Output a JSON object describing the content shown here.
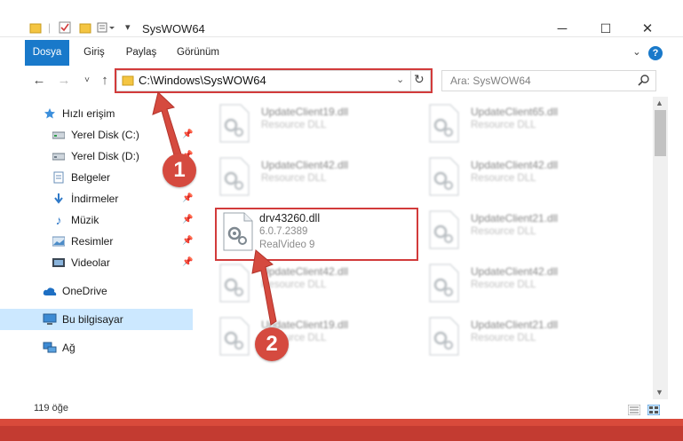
{
  "window": {
    "title": "SysWOW64",
    "minimize": "─",
    "maximize": "☐",
    "close": "✕"
  },
  "ribbon": {
    "tabs": [
      {
        "label": "Dosya",
        "active": true
      },
      {
        "label": "Giriş",
        "active": false
      },
      {
        "label": "Paylaş",
        "active": false
      },
      {
        "label": "Görünüm",
        "active": false
      }
    ],
    "help": "?"
  },
  "address": {
    "path": "C:\\Windows\\SysWOW64",
    "search_placeholder": "Ara: SysWOW64"
  },
  "sidebar": {
    "items": [
      {
        "label": "Hızlı erişim",
        "icon": "star-icon"
      },
      {
        "label": "Yerel Disk (C:)",
        "icon": "drive-icon"
      },
      {
        "label": "Yerel Disk (D:)",
        "icon": "drive-icon"
      },
      {
        "label": "Belgeler",
        "icon": "documents-icon"
      },
      {
        "label": "İndirmeler",
        "icon": "download-icon"
      },
      {
        "label": "Müzik",
        "icon": "music-icon"
      },
      {
        "label": "Resimler",
        "icon": "pictures-icon"
      },
      {
        "label": "Videolar",
        "icon": "videos-icon"
      },
      {
        "label": "OneDrive",
        "icon": "cloud-icon"
      },
      {
        "label": "Bu bilgisayar",
        "icon": "computer-icon"
      },
      {
        "label": "Ağ",
        "icon": "network-icon"
      }
    ]
  },
  "files": [
    {
      "name": "UpdateClient19.dll",
      "type": "Resource DLL"
    },
    {
      "name": "UpdateClient65.dll",
      "type": "Resource DLL"
    },
    {
      "name": "UpdateClient42.dll",
      "type": "Resource DLL"
    },
    {
      "name": "UpdateClient42.dll",
      "type": "Resource DLL"
    },
    {
      "name": "drv43260.dll",
      "version": "6.0.7.2389",
      "type": "RealVideo 9"
    },
    {
      "name": "UpdateClient21.dll",
      "type": "Resource DLL"
    },
    {
      "name": "UpdateClient42.dll",
      "type": "Resource DLL"
    },
    {
      "name": "UpdateClient42.dll",
      "type": "Resource DLL"
    },
    {
      "name": "UpdateClient19.dll",
      "type": "Resource DLL"
    },
    {
      "name": "UpdateClient21.dll",
      "type": "Resource DLL"
    }
  ],
  "status": {
    "count": "119 öğe"
  },
  "annotations": {
    "step1": "1",
    "step2": "2",
    "color": "#d23b3b"
  }
}
